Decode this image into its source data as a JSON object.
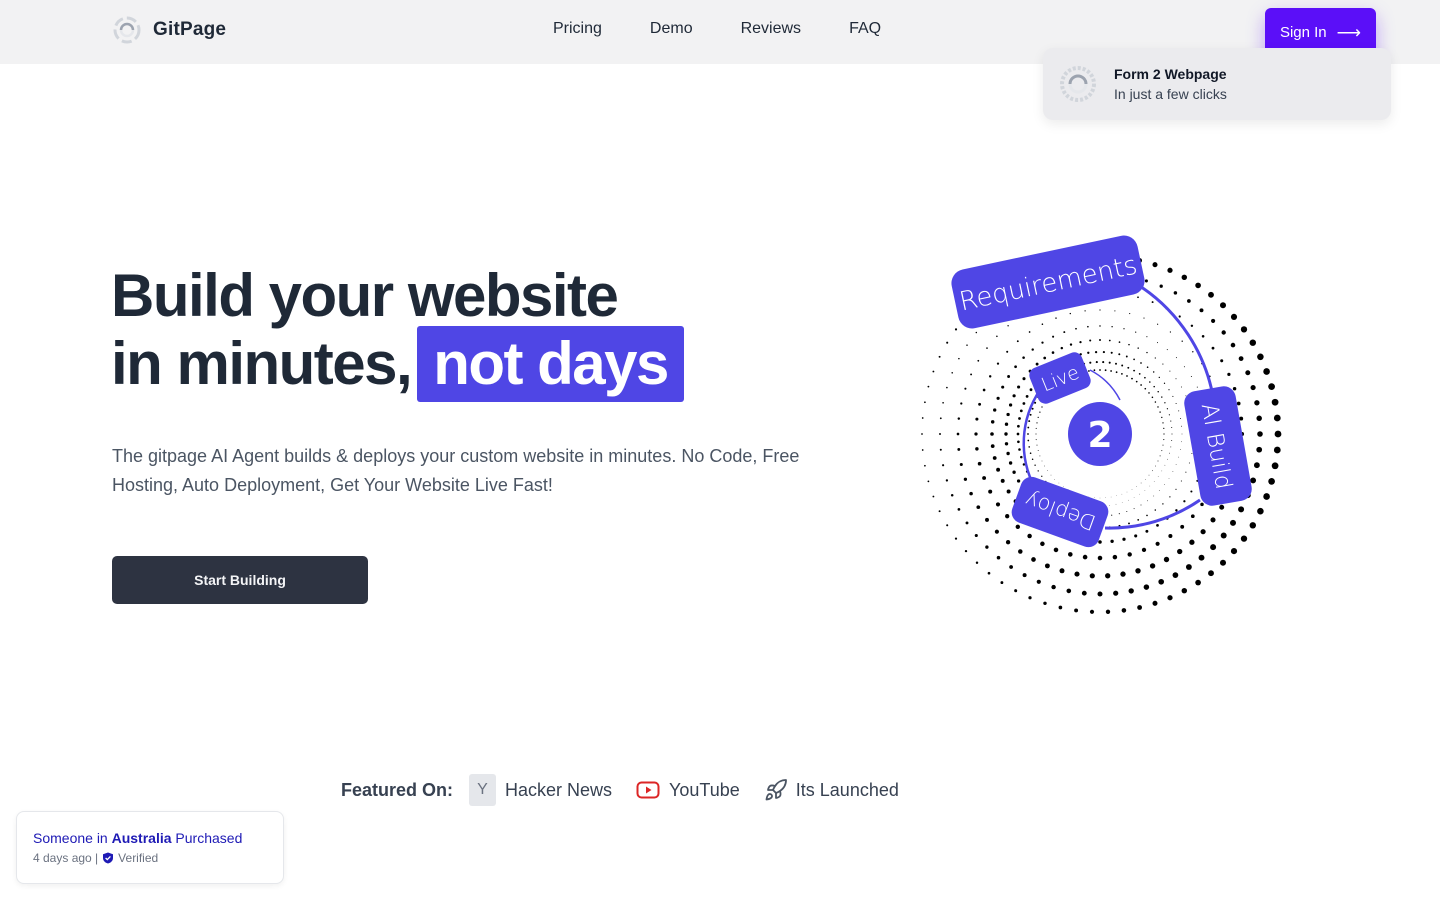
{
  "header": {
    "brand_name": "GitPage",
    "nav": [
      "Pricing",
      "Demo",
      "Reviews",
      "FAQ"
    ],
    "sign_in_label": "Sign In",
    "sign_in_icon": "arrow-right-icon"
  },
  "toast": {
    "title": "Form 2 Webpage",
    "subtitle": "In just a few clicks"
  },
  "hero": {
    "title_line1": "Build your website",
    "title_line2": "in minutes,",
    "title_highlight": "not days",
    "description": "The gitpage AI Agent builds & deploys your custom website in minutes. No Code, Free Hosting, Auto Deployment, Get Your Website Live Fast!",
    "cta_label": "Start Building"
  },
  "diagram": {
    "center_label": "2",
    "steps": [
      "Requirements",
      "AI Build",
      "Deploy",
      "Live"
    ]
  },
  "featured": {
    "label": "Featured On:",
    "items": [
      {
        "name": "Hacker News",
        "icon": "y-combinator-icon",
        "glyph": "Y"
      },
      {
        "name": "YouTube",
        "icon": "youtube-icon"
      },
      {
        "name": "Its Launched",
        "icon": "rocket-icon"
      }
    ]
  },
  "purchase_notice": {
    "prefix": "Someone in",
    "location": "Australia",
    "suffix": "Purchased",
    "time": "4 days ago |",
    "verified": "Verified"
  },
  "colors": {
    "accent": "#4f46e5",
    "sign_in": "#5b0ff8",
    "cta": "#2d3341",
    "text_dark": "#1f2937",
    "purchase_text": "#1e1ab5"
  }
}
